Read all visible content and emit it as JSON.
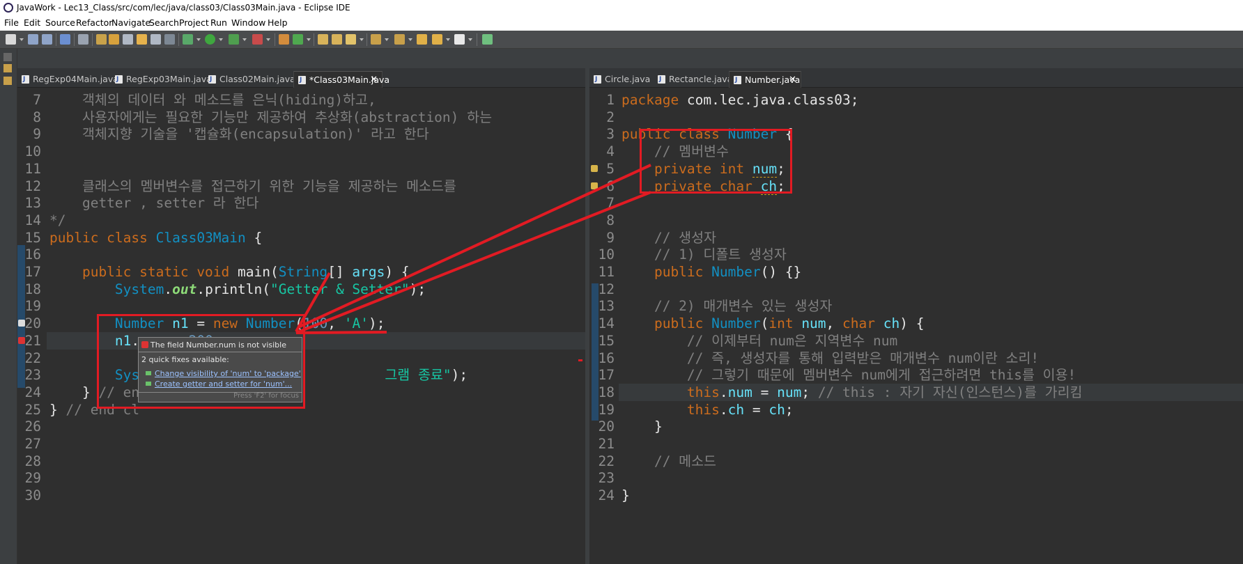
{
  "window": {
    "title": "JavaWork - Lec13_Class/src/com/lec/java/class03/Class03Main.java - Eclipse IDE"
  },
  "menu": [
    "File",
    "Edit",
    "Source",
    "Refactor",
    "Navigate",
    "Search",
    "Project",
    "Run",
    "Window",
    "Help"
  ],
  "left_tabs": [
    {
      "label": "RegExp04Main.java",
      "active": false
    },
    {
      "label": "RegExp03Main.java",
      "active": false
    },
    {
      "label": "Class02Main.java",
      "active": false
    },
    {
      "label": "*Class03Main.java",
      "active": true
    }
  ],
  "right_tabs": [
    {
      "label": "Circle.java",
      "active": false
    },
    {
      "label": "Rectancle.java",
      "active": false
    },
    {
      "label": "Number.java",
      "active": true
    }
  ],
  "left_lines": [
    {
      "n": "7",
      "html": "<span class=\"cm\">    객체의 데이터 와 메소드를 은닉(hiding)하고,</span>"
    },
    {
      "n": "8",
      "html": "<span class=\"cm\">    사용자에게는 필요한 기능만 제공하여 추상화(abstraction) 하는</span>"
    },
    {
      "n": "9",
      "html": "<span class=\"cm\">    객체지향 기술을 '캡슐화(encapsulation)' 라고 한다</span>"
    },
    {
      "n": "10",
      "html": ""
    },
    {
      "n": "11",
      "html": ""
    },
    {
      "n": "12",
      "html": "<span class=\"cm\">    클래스의 멤버변수를 접근하기 위한 기능을 제공하는 메소드를</span>"
    },
    {
      "n": "13",
      "html": "<span class=\"cm\">    getter , setter 라 한다</span>"
    },
    {
      "n": "14",
      "html": "<span class=\"cm\">*/</span>"
    },
    {
      "n": "15",
      "html": "<span class=\"kw\">public class </span><span class=\"cls\">Class03Main</span><span class=\"wht\"> {</span>"
    },
    {
      "n": "16",
      "html": ""
    },
    {
      "n": "17",
      "html": "<span class=\"kw\">    public static void </span><span class=\"wht\">main(</span><span class=\"cls\">String</span><span class=\"wht\">[] </span><span class=\"fld\">args</span><span class=\"wht\">) {</span>"
    },
    {
      "n": "18",
      "html": "<span class=\"cls\">        System</span><span class=\"wht\">.</span><span class=\"sta\">out</span><span class=\"wht\">.println(</span><span class=\"str\">\"Getter &amp; Setter\"</span><span class=\"wht\">);</span>"
    },
    {
      "n": "19",
      "html": ""
    },
    {
      "n": "20",
      "html": "<span class=\"cls\">        Number </span><span class=\"fld\">n1</span><span class=\"wht\"> = </span><span class=\"kw\">new </span><span class=\"cls\">Number</span><span class=\"wht\">(</span><span class=\"num\">100</span><span class=\"wht\">, </span><span class=\"str\">'A'</span><span class=\"wht\">);</span>"
    },
    {
      "n": "21",
      "html": "<span class=\"fld\">        n1</span><span class=\"wht\">.</span><span class=\"fld err\">num</span><span class=\"wht\"> = </span><span class=\"num\">200</span><span class=\"wht\">;</span>",
      "hl": true
    },
    {
      "n": "22",
      "html": ""
    },
    {
      "n": "23",
      "html": "<span class=\"cls\">        Sys</span><span class=\"wht\">                              </span><span class=\"str\">그램 종료\"</span><span class=\"wht\">);</span>"
    },
    {
      "n": "24",
      "html": "<span class=\"wht\">    } </span><span class=\"cm\">// en</span>"
    },
    {
      "n": "25",
      "html": "<span class=\"wht\">} </span><span class=\"cm\">// end cl</span>"
    },
    {
      "n": "26",
      "html": ""
    },
    {
      "n": "27",
      "html": ""
    },
    {
      "n": "28",
      "html": ""
    },
    {
      "n": "29",
      "html": ""
    },
    {
      "n": "30",
      "html": ""
    }
  ],
  "right_lines": [
    {
      "n": "1",
      "html": "<span class=\"kw\">package </span><span class=\"wht\">com.lec.java.class03;</span>"
    },
    {
      "n": "2",
      "html": ""
    },
    {
      "n": "3",
      "html": "<span class=\"kw\">public class </span><span class=\"cls\">Number</span><span class=\"wht\"> {</span>"
    },
    {
      "n": "4",
      "html": "<span class=\"cm\">    // 멤버변수</span>"
    },
    {
      "n": "5",
      "html": "<span class=\"kw\">    private int </span><span class=\"fld squig\">num</span><span class=\"wht\">;</span>"
    },
    {
      "n": "6",
      "html": "<span class=\"kw\">    private char </span><span class=\"fld squig\">ch</span><span class=\"wht\">;</span>"
    },
    {
      "n": "7",
      "html": ""
    },
    {
      "n": "8",
      "html": ""
    },
    {
      "n": "9",
      "html": "<span class=\"cm\">    // 생성자</span>"
    },
    {
      "n": "10",
      "html": "<span class=\"cm\">    // 1) 디폴트 생성자</span>"
    },
    {
      "n": "11",
      "html": "<span class=\"kw\">    public </span><span class=\"cls\">Number</span><span class=\"wht\">() {}</span>"
    },
    {
      "n": "12",
      "html": ""
    },
    {
      "n": "13",
      "html": "<span class=\"cm\">    // 2) 매개변수 있는 생성자</span>"
    },
    {
      "n": "14",
      "html": "<span class=\"kw\">    public </span><span class=\"cls\">Number</span><span class=\"wht\">(</span><span class=\"kw\">int </span><span class=\"fld\">num</span><span class=\"wht\">, </span><span class=\"kw\">char </span><span class=\"fld\">ch</span><span class=\"wht\">) {</span>"
    },
    {
      "n": "15",
      "html": "<span class=\"cm\">        // 이제부터 num은 지역변수 num</span>"
    },
    {
      "n": "16",
      "html": "<span class=\"cm\">        // 즉, 생성자를 통해 입력받은 매개변수 num이란 소리!</span>"
    },
    {
      "n": "17",
      "html": "<span class=\"cm\">        // 그렇기 때문에 멤버변수 num에게 접근하려면 this를 이용!</span>"
    },
    {
      "n": "18",
      "html": "<span class=\"kw\">        this</span><span class=\"wht\">.</span><span class=\"fld\">num</span><span class=\"wht\"> = </span><span class=\"fld\">num</span><span class=\"wht\">; </span><span class=\"cm\">// this : 자기 자신(인스턴스)를 가리킴</span>",
      "hl": true
    },
    {
      "n": "19",
      "html": "<span class=\"kw\">        this</span><span class=\"wht\">.</span><span class=\"fld\">ch</span><span class=\"wht\"> = </span><span class=\"fld\">ch</span><span class=\"wht\">;</span>"
    },
    {
      "n": "20",
      "html": "<span class=\"wht\">    }</span>"
    },
    {
      "n": "21",
      "html": ""
    },
    {
      "n": "22",
      "html": "<span class=\"cm\">    // 메소드</span>"
    },
    {
      "n": "23",
      "html": ""
    },
    {
      "n": "24",
      "html": "<span class=\"wht\">}</span>"
    }
  ],
  "popup": {
    "title": "The field Number.num is not visible",
    "subtitle": "2 quick fixes available:",
    "fixes": [
      "Change visibility of 'num' to 'package'",
      "Create getter and setter for 'num'..."
    ],
    "footer": "Press 'F2' for focus"
  },
  "colors": {
    "annotation": "#e21b23",
    "background": "#2f2f2f",
    "keyword": "#cc6c1d",
    "type": "#1290c3",
    "field": "#66e1f8",
    "string": "#17c6a3",
    "comment": "#808080"
  }
}
